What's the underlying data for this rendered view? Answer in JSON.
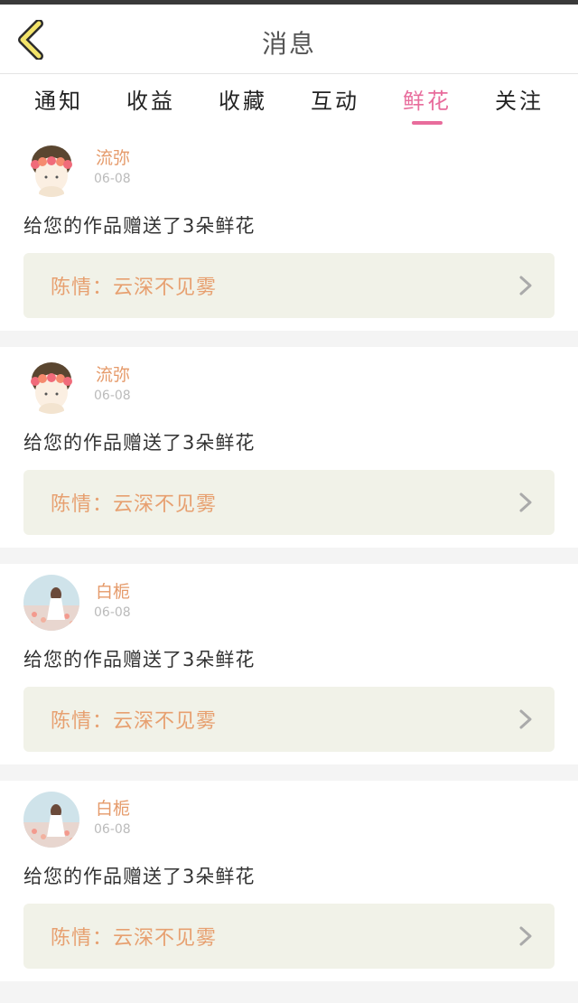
{
  "header": {
    "title": "消息"
  },
  "tabs": [
    {
      "label": "通知"
    },
    {
      "label": "收益"
    },
    {
      "label": "收藏"
    },
    {
      "label": "互动"
    },
    {
      "label": "鲜花",
      "active": true
    },
    {
      "label": "关注"
    }
  ],
  "messages": [
    {
      "username": "流弥",
      "date": "06-08",
      "text": "给您的作品赠送了3朵鲜花",
      "work": "陈情：云深不见雾",
      "avatar": "flower-crown-avatar"
    },
    {
      "username": "流弥",
      "date": "06-08",
      "text": "给您的作品赠送了3朵鲜花",
      "work": "陈情：云深不见雾",
      "avatar": "flower-crown-avatar"
    },
    {
      "username": "白栀",
      "date": "06-08",
      "text": "给您的作品赠送了3朵鲜花",
      "work": "陈情：云深不见雾",
      "avatar": "girl-in-field-avatar"
    },
    {
      "username": "白栀",
      "date": "06-08",
      "text": "给您的作品赠送了3朵鲜花",
      "work": "陈情：云深不见雾",
      "avatar": "girl-in-field-avatar"
    }
  ],
  "colors": {
    "accent": "#e86c9c",
    "username": "#e59a6a",
    "work_title": "#e7a070",
    "link_bg": "#f1f2e8"
  }
}
